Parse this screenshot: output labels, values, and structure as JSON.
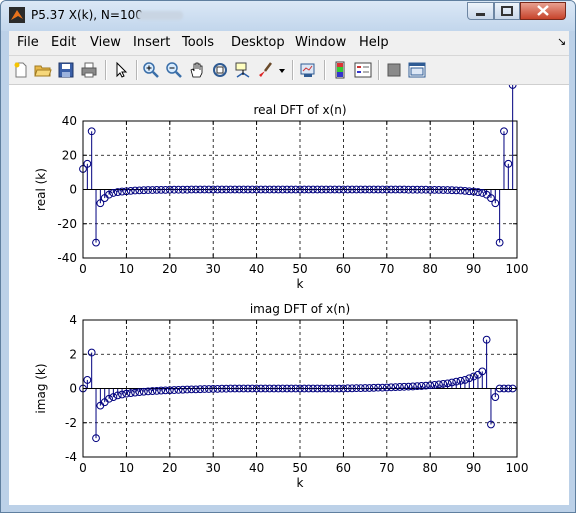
{
  "window": {
    "title": "P5.37 X(k), N=100"
  },
  "menu": {
    "items": [
      "File",
      "Edit",
      "View",
      "Insert",
      "Tools",
      "Desktop",
      "Window",
      "Help"
    ],
    "arrow": "↘"
  },
  "toolbar": {
    "icons": [
      "new-figure-icon",
      "open-file-icon",
      "save-icon",
      "print-icon",
      "pointer-icon",
      "zoom-in-icon",
      "zoom-out-icon",
      "pan-icon",
      "rotate-3d-icon",
      "data-cursor-icon",
      "brush-icon",
      "dropdown-arrow-icon",
      "link-plot-icon",
      "colorbar-icon",
      "legend-icon",
      "hide-plot-tools-icon",
      "show-plot-tools-icon"
    ]
  },
  "chart_data": [
    {
      "type": "stem",
      "title": "real DFT of x(n)",
      "xlabel": "k",
      "ylabel": "real (k)",
      "xlim": [
        0,
        100
      ],
      "ylim": [
        -40,
        40
      ],
      "xticks": [
        0,
        10,
        20,
        30,
        40,
        50,
        60,
        70,
        80,
        90,
        100
      ],
      "yticks": [
        -40,
        -20,
        0,
        20,
        40
      ],
      "grid": true,
      "x": [
        0,
        1,
        2,
        3,
        4,
        5,
        6,
        7,
        8,
        9,
        10,
        11,
        12,
        13,
        14,
        15,
        16,
        17,
        18,
        19,
        20,
        21,
        22,
        23,
        24,
        25,
        26,
        27,
        28,
        29,
        30,
        31,
        32,
        33,
        34,
        35,
        36,
        37,
        38,
        39,
        40,
        41,
        42,
        43,
        44,
        45,
        46,
        47,
        48,
        49,
        50,
        51,
        52,
        53,
        54,
        55,
        56,
        57,
        58,
        59,
        60,
        61,
        62,
        63,
        64,
        65,
        66,
        67,
        68,
        69,
        70,
        71,
        72,
        73,
        74,
        75,
        76,
        77,
        78,
        79,
        80,
        81,
        82,
        83,
        84,
        85,
        86,
        87,
        88,
        89,
        90,
        91,
        92,
        93,
        94,
        95,
        96,
        97,
        98,
        99
      ],
      "y": [
        12,
        15,
        34,
        -31,
        -8,
        -5,
        -3,
        -2,
        -1.5,
        -1.2,
        -1,
        -0.8,
        -0.6,
        -0.5,
        -0.4,
        -0.3,
        -0.3,
        -0.2,
        -0.2,
        -0.2,
        -0.1,
        -0.1,
        -0.1,
        -0.1,
        -0.1,
        0,
        0,
        0,
        0,
        0,
        0,
        0,
        0,
        0,
        0,
        0,
        0,
        0,
        0,
        0,
        0,
        0,
        0,
        0,
        0,
        0,
        0,
        0,
        0,
        0,
        0,
        0,
        0,
        0,
        0,
        0,
        0,
        0,
        0,
        0,
        0,
        0,
        0,
        0,
        0,
        0,
        0,
        0,
        0,
        0,
        0,
        0,
        0,
        0,
        0,
        -0.1,
        -0.1,
        -0.1,
        -0.1,
        -0.1,
        -0.2,
        -0.2,
        -0.2,
        -0.3,
        -0.3,
        -0.4,
        -0.5,
        -0.6,
        -0.8,
        -1,
        -1.2,
        -1.5,
        -2,
        -3,
        -5,
        -8,
        -31,
        34,
        15
      ]
    },
    {
      "type": "stem",
      "title": "imag DFT of x(n)",
      "xlabel": "k",
      "ylabel": "imag (k)",
      "xlim": [
        0,
        100
      ],
      "ylim": [
        -4,
        4
      ],
      "xticks": [
        0,
        10,
        20,
        30,
        40,
        50,
        60,
        70,
        80,
        90,
        100
      ],
      "yticks": [
        -4,
        -2,
        0,
        2,
        4
      ],
      "grid": true,
      "x": [
        0,
        1,
        2,
        3,
        4,
        5,
        6,
        7,
        8,
        9,
        10,
        11,
        12,
        13,
        14,
        15,
        16,
        17,
        18,
        19,
        20,
        21,
        22,
        23,
        24,
        25,
        26,
        27,
        28,
        29,
        30,
        31,
        32,
        33,
        34,
        35,
        36,
        37,
        38,
        39,
        40,
        41,
        42,
        43,
        44,
        45,
        46,
        47,
        48,
        49,
        50,
        51,
        52,
        53,
        54,
        55,
        56,
        57,
        58,
        59,
        60,
        61,
        62,
        63,
        64,
        65,
        66,
        67,
        68,
        69,
        70,
        71,
        72,
        73,
        74,
        75,
        76,
        77,
        78,
        79,
        80,
        81,
        82,
        83,
        84,
        85,
        86,
        87,
        88,
        89,
        90,
        91,
        92,
        93,
        94,
        95,
        96,
        97,
        98,
        99
      ],
      "y": [
        0,
        0.5,
        2.1,
        -2.9,
        -1,
        -0.8,
        -0.6,
        -0.5,
        -0.4,
        -0.35,
        -0.3,
        -0.27,
        -0.24,
        -0.21,
        -0.19,
        -0.17,
        -0.15,
        -0.14,
        -0.12,
        -0.11,
        -0.1,
        -0.09,
        -0.08,
        -0.07,
        -0.06,
        -0.05,
        -0.05,
        -0.04,
        -0.03,
        -0.03,
        -0.02,
        -0.02,
        -0.01,
        -0.01,
        0,
        0,
        0,
        0,
        0,
        0,
        0,
        0,
        0,
        0,
        0,
        0,
        0,
        0,
        0,
        0,
        0,
        0,
        0,
        0,
        0,
        0,
        0,
        0,
        0,
        0,
        0,
        0.01,
        0.01,
        0.02,
        0.02,
        0.03,
        0.03,
        0.04,
        0.05,
        0.05,
        0.06,
        0.07,
        0.08,
        0.09,
        0.1,
        0.11,
        0.12,
        0.14,
        0.15,
        0.17,
        0.19,
        0.21,
        0.24,
        0.27,
        0.3,
        0.35,
        0.4,
        0.45,
        0.5,
        0.6,
        0.7,
        0.8,
        1,
        2.85,
        -2.1,
        -0.5,
        0,
        0,
        0,
        0
      ]
    }
  ]
}
